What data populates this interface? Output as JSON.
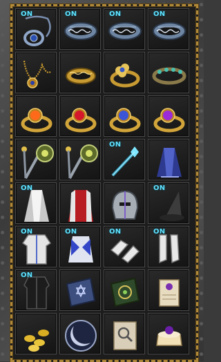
{
  "inventory": {
    "slots": [
      {
        "item": "sapphire-amulet-icon",
        "equipped": true,
        "on_label": "ON"
      },
      {
        "item": "silver-runed-ring-icon",
        "equipped": true,
        "on_label": "ON"
      },
      {
        "item": "silver-runed-ring-icon",
        "equipped": true,
        "on_label": "ON"
      },
      {
        "item": "silver-runed-ring-icon",
        "equipped": true,
        "on_label": "ON"
      },
      {
        "item": "gold-necklace-icon",
        "equipped": false,
        "on_label": ""
      },
      {
        "item": "gold-band-ring-icon",
        "equipped": false,
        "on_label": ""
      },
      {
        "item": "gold-flower-ring-icon",
        "equipped": false,
        "on_label": ""
      },
      {
        "item": "gold-gem-band-icon",
        "equipped": false,
        "on_label": ""
      },
      {
        "item": "orange-gem-ring-icon",
        "equipped": false,
        "on_label": ""
      },
      {
        "item": "ruby-ring-icon",
        "equipped": false,
        "on_label": ""
      },
      {
        "item": "sapphire-ring-icon",
        "equipped": false,
        "on_label": ""
      },
      {
        "item": "amethyst-ring-icon",
        "equipped": false,
        "on_label": ""
      },
      {
        "item": "ornate-staff-icon",
        "equipped": false,
        "on_label": ""
      },
      {
        "item": "ornate-staff-icon",
        "equipped": false,
        "on_label": ""
      },
      {
        "item": "crystal-wand-icon",
        "equipped": true,
        "on_label": "ON"
      },
      {
        "item": "dark-cape-icon",
        "equipped": false,
        "on_label": ""
      },
      {
        "item": "white-cape-icon",
        "equipped": true,
        "on_label": "ON"
      },
      {
        "item": "red-cape-icon",
        "equipped": false,
        "on_label": ""
      },
      {
        "item": "steel-helmet-icon",
        "equipped": false,
        "on_label": ""
      },
      {
        "item": "wizard-hat-icon",
        "equipped": true,
        "on_label": "ON"
      },
      {
        "item": "white-robe-icon",
        "equipped": true,
        "on_label": "ON"
      },
      {
        "item": "blue-armor-icon",
        "equipped": true,
        "on_label": "ON"
      },
      {
        "item": "white-gloves-icon",
        "equipped": true,
        "on_label": "ON"
      },
      {
        "item": "white-boots-icon",
        "equipped": true,
        "on_label": "ON"
      },
      {
        "item": "dark-robe-icon",
        "equipped": true,
        "on_label": "ON"
      },
      {
        "item": "blue-spellbook-icon",
        "equipped": false,
        "on_label": ""
      },
      {
        "item": "green-spellbook-icon",
        "equipped": false,
        "on_label": ""
      },
      {
        "item": "scroll-icon",
        "equipped": false,
        "on_label": ""
      },
      {
        "item": "gold-coins-icon",
        "equipped": false,
        "on_label": ""
      },
      {
        "item": "moon-orb-icon",
        "equipped": false,
        "on_label": ""
      },
      {
        "item": "magnifier-scroll-icon",
        "equipped": false,
        "on_label": ""
      },
      {
        "item": "gem-cake-icon",
        "equipped": false,
        "on_label": ""
      }
    ]
  },
  "colors": {
    "on_label": "#5fe3ff",
    "frame_gold": "#b08a3a",
    "slot_bg": "#1a1a1a"
  }
}
